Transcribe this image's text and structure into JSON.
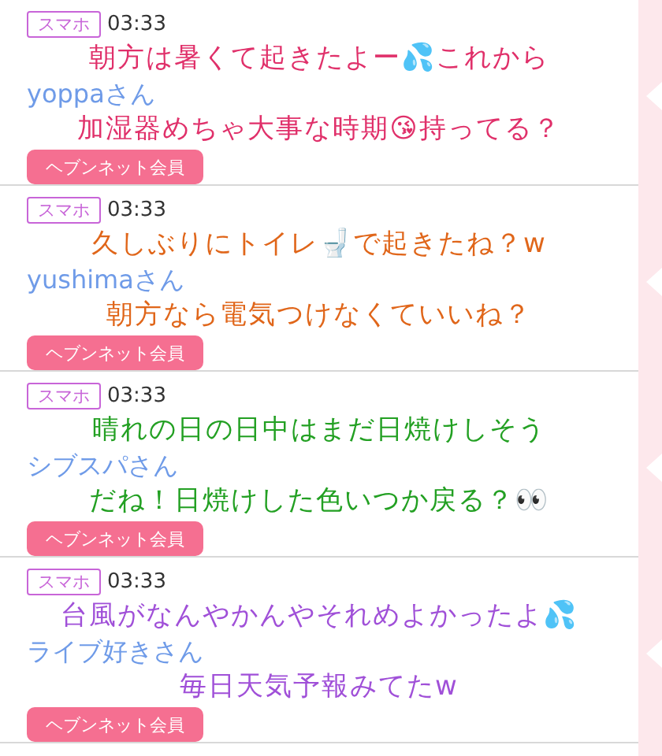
{
  "posts": [
    {
      "badge": "スマホ",
      "time": "03:33",
      "name": "yoppaさん",
      "member_button": "ヘブンネット会員",
      "caption": {
        "color": "#e0306a",
        "lines": [
          "朝方は暑くて起きたよー💦これから",
          "加湿器めちゃ大事な時期😘持ってる？"
        ]
      }
    },
    {
      "badge": "スマホ",
      "time": "03:33",
      "name": "yushimaさん",
      "member_button": "ヘブンネット会員",
      "caption": {
        "color": "#e0661a",
        "lines": [
          "久しぶりにトイレ🚽で起きたね？w",
          "朝方なら電気つけなくていいね？"
        ]
      }
    },
    {
      "badge": "スマホ",
      "time": "03:33",
      "name": "シブスパさん",
      "member_button": "ヘブンネット会員",
      "caption": {
        "color": "#23a023",
        "lines": [
          "晴れの日の日中はまだ日焼けしそう",
          "だね！日焼けした色いつか戻る？👀"
        ]
      }
    },
    {
      "badge": "スマホ",
      "time": "03:33",
      "name": "ライブ好きさん",
      "member_button": "ヘブンネット会員",
      "caption": {
        "color": "#a050d8",
        "lines": [
          "台風がなんやかんやそれめよかったよ💦",
          "毎日天気予報みてたw"
        ]
      }
    }
  ]
}
